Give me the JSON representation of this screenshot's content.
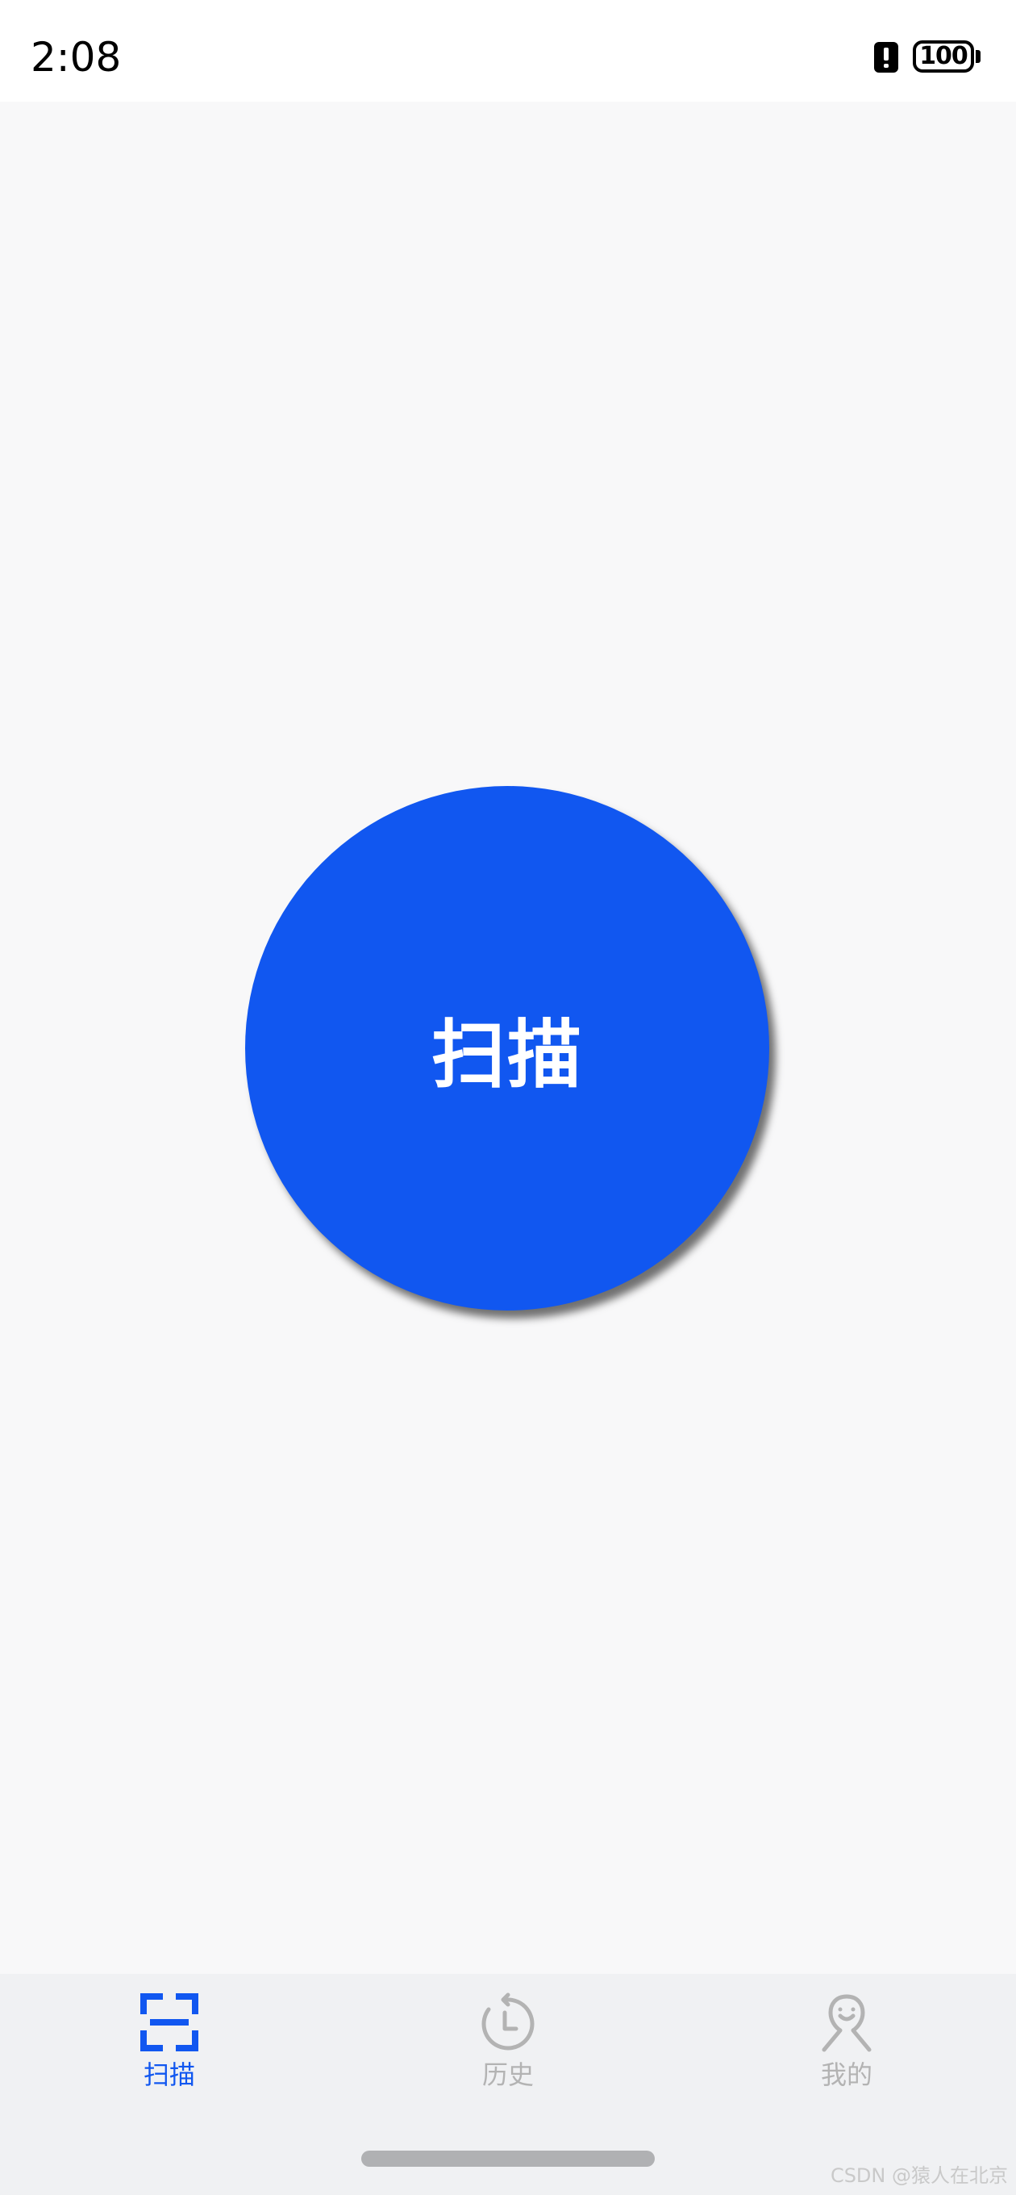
{
  "status_bar": {
    "time": "2:08",
    "battery_level": "100",
    "alert_icon": "exclamation-icon"
  },
  "main": {
    "scan_button_label": "扫描",
    "accent_color": "#1157f0"
  },
  "tab_bar": {
    "tabs": [
      {
        "label": "扫描",
        "icon": "scan-icon",
        "active": true
      },
      {
        "label": "历史",
        "icon": "history-icon",
        "active": false
      },
      {
        "label": "我的",
        "icon": "profile-icon",
        "active": false
      }
    ],
    "active_color": "#1157f0",
    "inactive_color": "#b3b3b3"
  },
  "watermark": "CSDN @猿人在北京"
}
